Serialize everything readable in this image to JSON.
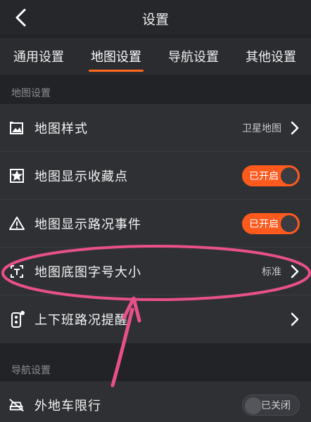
{
  "header": {
    "title": "设置"
  },
  "tabs": [
    {
      "label": "通用设置"
    },
    {
      "label": "地图设置"
    },
    {
      "label": "导航设置"
    },
    {
      "label": "其他设置"
    }
  ],
  "sections": {
    "map": {
      "label": "地图设置",
      "rows": [
        {
          "label": "地图样式",
          "value": "卫星地图",
          "icon": "map-style-icon"
        },
        {
          "label": "地图显示收藏点",
          "toggle": "已开启",
          "icon": "star-icon"
        },
        {
          "label": "地图显示路况事件",
          "toggle": "已开启",
          "icon": "warning-icon"
        },
        {
          "label": "地图底图字号大小",
          "value": "标准",
          "icon": "font-size-icon"
        },
        {
          "label": "上下班路况提醒",
          "icon": "traffic-light-icon"
        }
      ]
    },
    "nav": {
      "label": "导航设置",
      "rows": [
        {
          "label": "外地车限行",
          "toggle": "已关闭",
          "icon": "car-restriction-icon"
        }
      ]
    }
  },
  "colors": {
    "accent": "#ff5a1e",
    "annotation": "#e8508a"
  }
}
